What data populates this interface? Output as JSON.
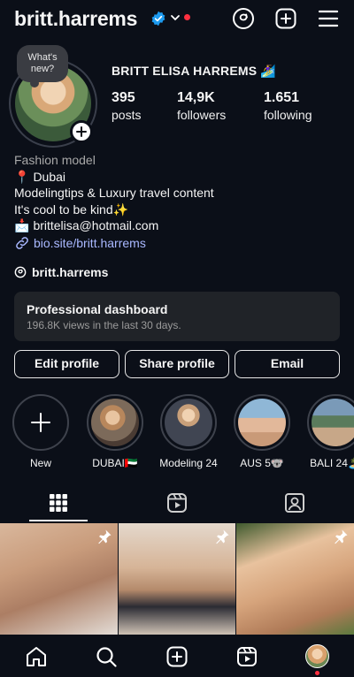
{
  "header": {
    "username": "britt.harrems",
    "verified_color": "#1d9bf0",
    "notification_dot_color": "#ff3040",
    "icons": [
      "threads-icon",
      "new-post-icon",
      "menu-icon"
    ]
  },
  "profile": {
    "bubble_text": "What's new?",
    "full_name": "BRITT ELISA HARREMS 🏄‍♀️",
    "stats": [
      {
        "value": "395",
        "label": "posts"
      },
      {
        "value": "14,9K",
        "label": "followers"
      },
      {
        "value": "1.651",
        "label": "following"
      }
    ],
    "bio": {
      "category": "Fashion model",
      "location": "Dubai",
      "line1": "Modelingtips & Luxury travel content",
      "line2": "It's cool to be kind✨",
      "email": "brittelisa@hotmail.com",
      "link": "bio.site/britt.harrems"
    },
    "threads_handle": "britt.harrems"
  },
  "dashboard": {
    "title": "Professional dashboard",
    "subtitle": "196.8K views in the last 30 days."
  },
  "buttons": {
    "edit": "Edit profile",
    "share": "Share profile",
    "email": "Email"
  },
  "highlights": [
    {
      "label": "New"
    },
    {
      "label": "DUBAI🇦🇪"
    },
    {
      "label": "Modeling 24"
    },
    {
      "label": "AUS 5🐨"
    },
    {
      "label": "BALI 24🏝️"
    }
  ],
  "tabs": [
    "grid-icon",
    "reels-icon",
    "tagged-icon"
  ],
  "grid": [
    {
      "pinned": true
    },
    {
      "pinned": true
    },
    {
      "pinned": true
    }
  ],
  "bottom_nav": [
    "home-icon",
    "search-icon",
    "create-icon",
    "reels-icon",
    "profile-avatar"
  ],
  "accent_link_color": "#a9b8ff"
}
